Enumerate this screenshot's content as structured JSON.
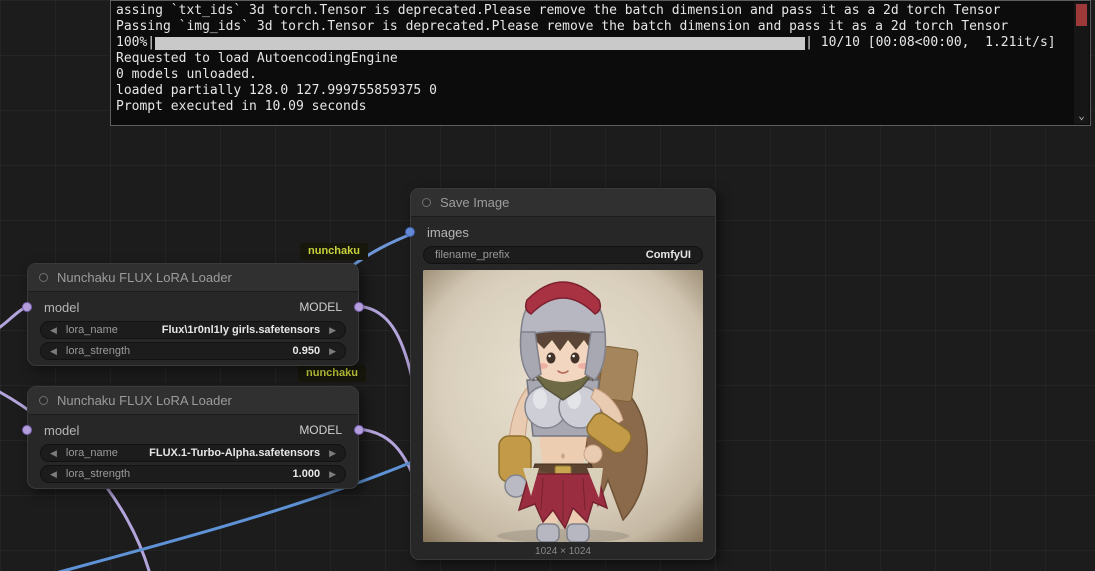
{
  "ui": {
    "arrow_left": "◀",
    "arrow_right": "▶",
    "scroll_down": "⌄"
  },
  "console": {
    "lines_before": [
      "assing `txt_ids` 3d torch.Tensor is deprecated.Please remove the batch dimension and pass it as a 2d torch Tensor",
      "Passing `img_ids` 3d torch.Tensor is deprecated.Please remove the batch dimension and pass it as a 2d torch Tensor"
    ],
    "progress": {
      "prefix": "100%|",
      "suffix": "| 10/10 [00:08<00:00,  1.21it/s]",
      "percent": 100
    },
    "lines_after": [
      "Requested to load AutoencodingEngine",
      "0 models unloaded.",
      "loaded partially 128.0 127.999755859375 0",
      "Prompt executed in 10.09 seconds"
    ]
  },
  "nodes": {
    "save_image": {
      "title": "Save Image",
      "input_label": "images",
      "widget": {
        "label": "filename_prefix",
        "value": "ComfyUI"
      },
      "image_caption": "1024 × 1024"
    },
    "lora_loader_1": {
      "title": "Nunchaku FLUX LoRA Loader",
      "badge": "nunchaku",
      "input_label": "model",
      "output_label": "MODEL",
      "widgets": [
        {
          "label": "lora_name",
          "value": "Flux\\1r0nl1ly girls.safetensors"
        },
        {
          "label": "lora_strength",
          "value": "0.950"
        }
      ]
    },
    "lora_loader_2": {
      "title": "Nunchaku FLUX LoRA Loader",
      "badge": "nunchaku",
      "input_label": "model",
      "output_label": "MODEL",
      "widgets": [
        {
          "label": "lora_name",
          "value": "FLUX.1-Turbo-Alpha.safetensors"
        },
        {
          "label": "lora_strength",
          "value": "1.000"
        }
      ]
    }
  },
  "colors": {
    "model_slot": "#b39ddb",
    "image_slot": "#6488d6",
    "wire_blue": "#6e96d8",
    "wire_purple": "#b4a4dc",
    "badge_text": "#c8d23c",
    "progress_fill": "#c9c9c9",
    "scroll_thumb": "#9e3939"
  }
}
